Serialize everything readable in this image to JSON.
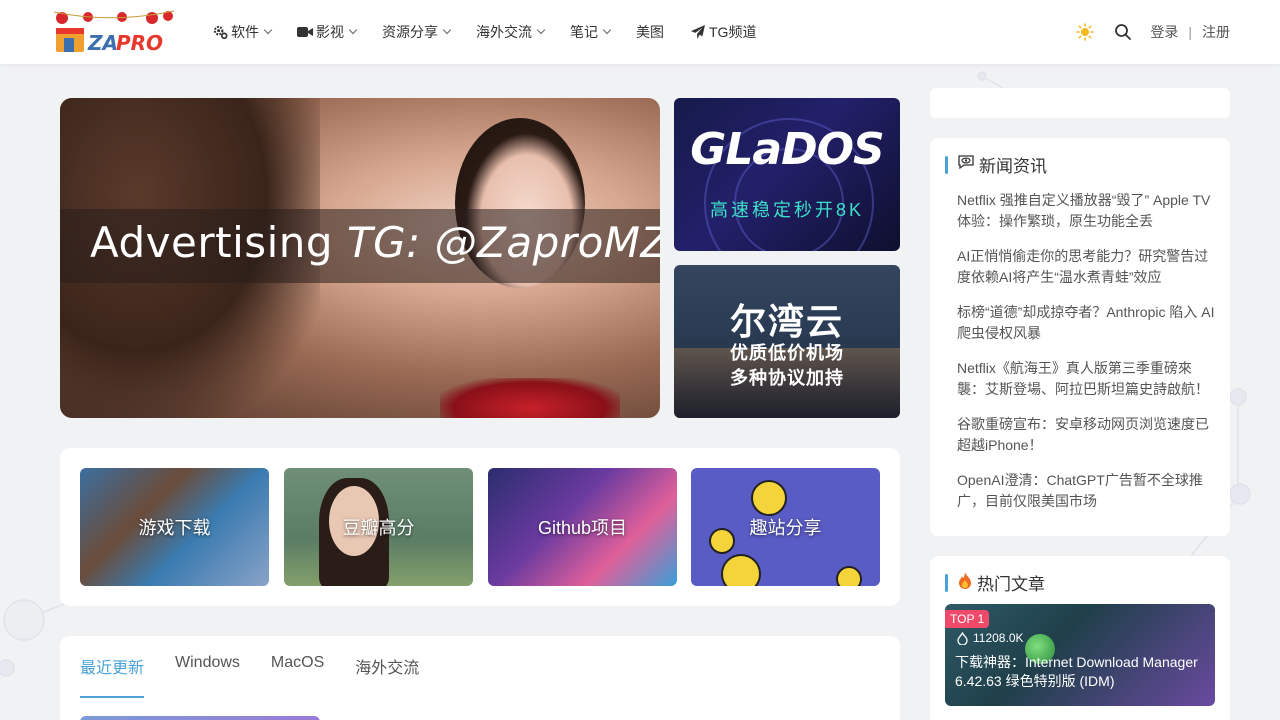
{
  "logo": {
    "text": "ZAPRO",
    "accent_color": "#e8382c"
  },
  "nav": [
    {
      "label": "软件",
      "icon": "gear-icon",
      "dropdown": true
    },
    {
      "label": "影视",
      "icon": "video-camera-icon",
      "dropdown": true
    },
    {
      "label": "资源分享",
      "icon": "",
      "dropdown": true
    },
    {
      "label": "海外交流",
      "icon": "",
      "dropdown": true
    },
    {
      "label": "笔记",
      "icon": "",
      "dropdown": true
    },
    {
      "label": "美图",
      "icon": "",
      "dropdown": false
    },
    {
      "label": "TG频道",
      "icon": "paper-plane-icon",
      "dropdown": false
    }
  ],
  "header": {
    "login": "登录",
    "separator": "|",
    "register": "注册"
  },
  "hero": {
    "text_plain": "Advertising ",
    "text_italic": "TG: @ZaproMZ"
  },
  "promos": [
    {
      "title": "GLaDOS",
      "subtitle": "高速稳定秒开8K"
    },
    {
      "title": "尔湾云",
      "line1": "优质低价机场",
      "line2": "多种协议加持"
    }
  ],
  "categories": [
    {
      "label": "游戏下载"
    },
    {
      "label": "豆瓣高分"
    },
    {
      "label": "Github项目"
    },
    {
      "label": "趣站分享"
    }
  ],
  "tabs": [
    {
      "label": "最近更新",
      "active": true
    },
    {
      "label": "Windows",
      "active": false
    },
    {
      "label": "MacOS",
      "active": false
    },
    {
      "label": "海外交流",
      "active": false
    }
  ],
  "sidebar": {
    "news_title": "新闻资讯",
    "news": [
      "Netflix 强推自定义播放器“毁了” Apple TV 体验：操作繁琐，原生功能全丢",
      "AI正悄悄偷走你的思考能力？研究警告过度依赖AI将产生“温水煮青蛙”效应",
      "标榜“道德”却成掠夺者？Anthropic 陷入 AI 爬虫侵权风暴",
      "Netflix《航海王》真人版第三季重磅來襲：艾斯登場、阿拉巴斯坦篇史詩啟航！",
      "谷歌重磅宣布：安卓移动网页浏览速度已超越iPhone！",
      "OpenAI澄清：ChatGPT广告暂不全球推广，目前仅限美国市场"
    ],
    "hot_title": "热门文章",
    "hot": {
      "badge": "TOP 1",
      "views": "11208.0K",
      "title": "下载神器：Internet Download Manager 6.42.63 绿色特别版 (IDM)"
    }
  },
  "colors": {
    "accent": "#4aa2d8",
    "hot_badge": "#f04a6a",
    "background": "#f1f2f4"
  }
}
